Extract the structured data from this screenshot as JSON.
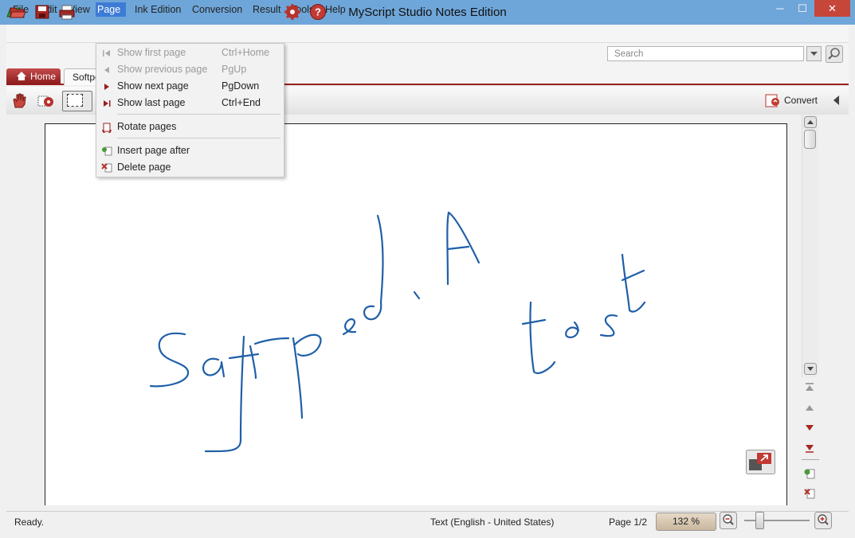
{
  "window": {
    "title": "MyScript Studio Notes Edition",
    "min": "─",
    "max": "☐",
    "close": "✕"
  },
  "menubar": [
    "File",
    "Edit",
    "View",
    "Page",
    "Ink Edition",
    "Conversion",
    "Result",
    "Tools",
    "Help"
  ],
  "toolbar": {
    "search_placeholder": "Search"
  },
  "tabs": {
    "home": "Home",
    "softpedia": "Softpe"
  },
  "toolbar2": {
    "convert": "Convert"
  },
  "page_menu": {
    "items": [
      {
        "label": "Show first page",
        "shortcut": "Ctrl+Home",
        "enabled": false
      },
      {
        "label": "Show previous page",
        "shortcut": "PgUp",
        "enabled": false
      },
      {
        "label": "Show next page",
        "shortcut": "PgDown",
        "enabled": true
      },
      {
        "label": "Show last page",
        "shortcut": "Ctrl+End",
        "enabled": true
      },
      {
        "label": "Rotate pages",
        "shortcut": "",
        "enabled": true
      },
      {
        "label": "Insert page after",
        "shortcut": "",
        "enabled": true
      },
      {
        "label": "Delete page",
        "shortcut": "",
        "enabled": true
      }
    ]
  },
  "status": {
    "left": "Ready.",
    "language": "Text (English - United States)",
    "page": "Page 1/2",
    "zoom": "132 %"
  },
  "colors": {
    "accent": "#9b1e1e",
    "ink": "#1f5fa8",
    "titlebar": "#6fa6d9",
    "menu_highlight": "#3d7bd6"
  }
}
